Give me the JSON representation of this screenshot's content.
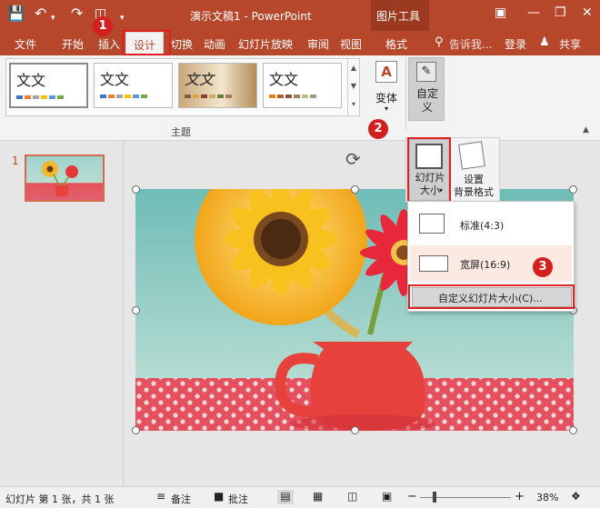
{
  "window": {
    "title": "演示文稿1 - PowerPoint",
    "context_tab_group": "图片工具",
    "minimize_icon": "minimize-icon",
    "restore_icon": "restore-icon",
    "close_icon": "close-icon"
  },
  "tabs": {
    "file": "文件",
    "home": "开始",
    "insert": "插入",
    "design": "设计",
    "transitions": "切换",
    "animations": "动画",
    "slideshow": "幻灯片放映",
    "review": "审阅",
    "view": "视图",
    "format": "格式",
    "tell_me": "告诉我...",
    "login": "登录",
    "share": "共享"
  },
  "ribbon": {
    "themes": [
      {
        "title": "文文"
      },
      {
        "title": "文文"
      },
      {
        "title": "文文"
      },
      {
        "title": "文文"
      }
    ],
    "variants_label": "变体",
    "group_label": "主题",
    "customize_label": "自定\n义",
    "slide_size_label": "幻灯片\n大小",
    "format_bg_label": "设置\n背景格式"
  },
  "dropdown": {
    "standard": "标准(4:3)",
    "widescreen": "宽屏(16:9)",
    "custom": "自定义幻灯片大小(C)..."
  },
  "annotations": {
    "step1": "1",
    "step2": "2",
    "step3": "3"
  },
  "thumbnail": {
    "number": "1"
  },
  "status": {
    "slide_info": "幻灯片 第 1 张，共 1 张",
    "notes": "备注",
    "comments": "批注",
    "zoom": "38%"
  },
  "colors": {
    "accent": "#b7472a",
    "annotation_red": "#e02020"
  }
}
